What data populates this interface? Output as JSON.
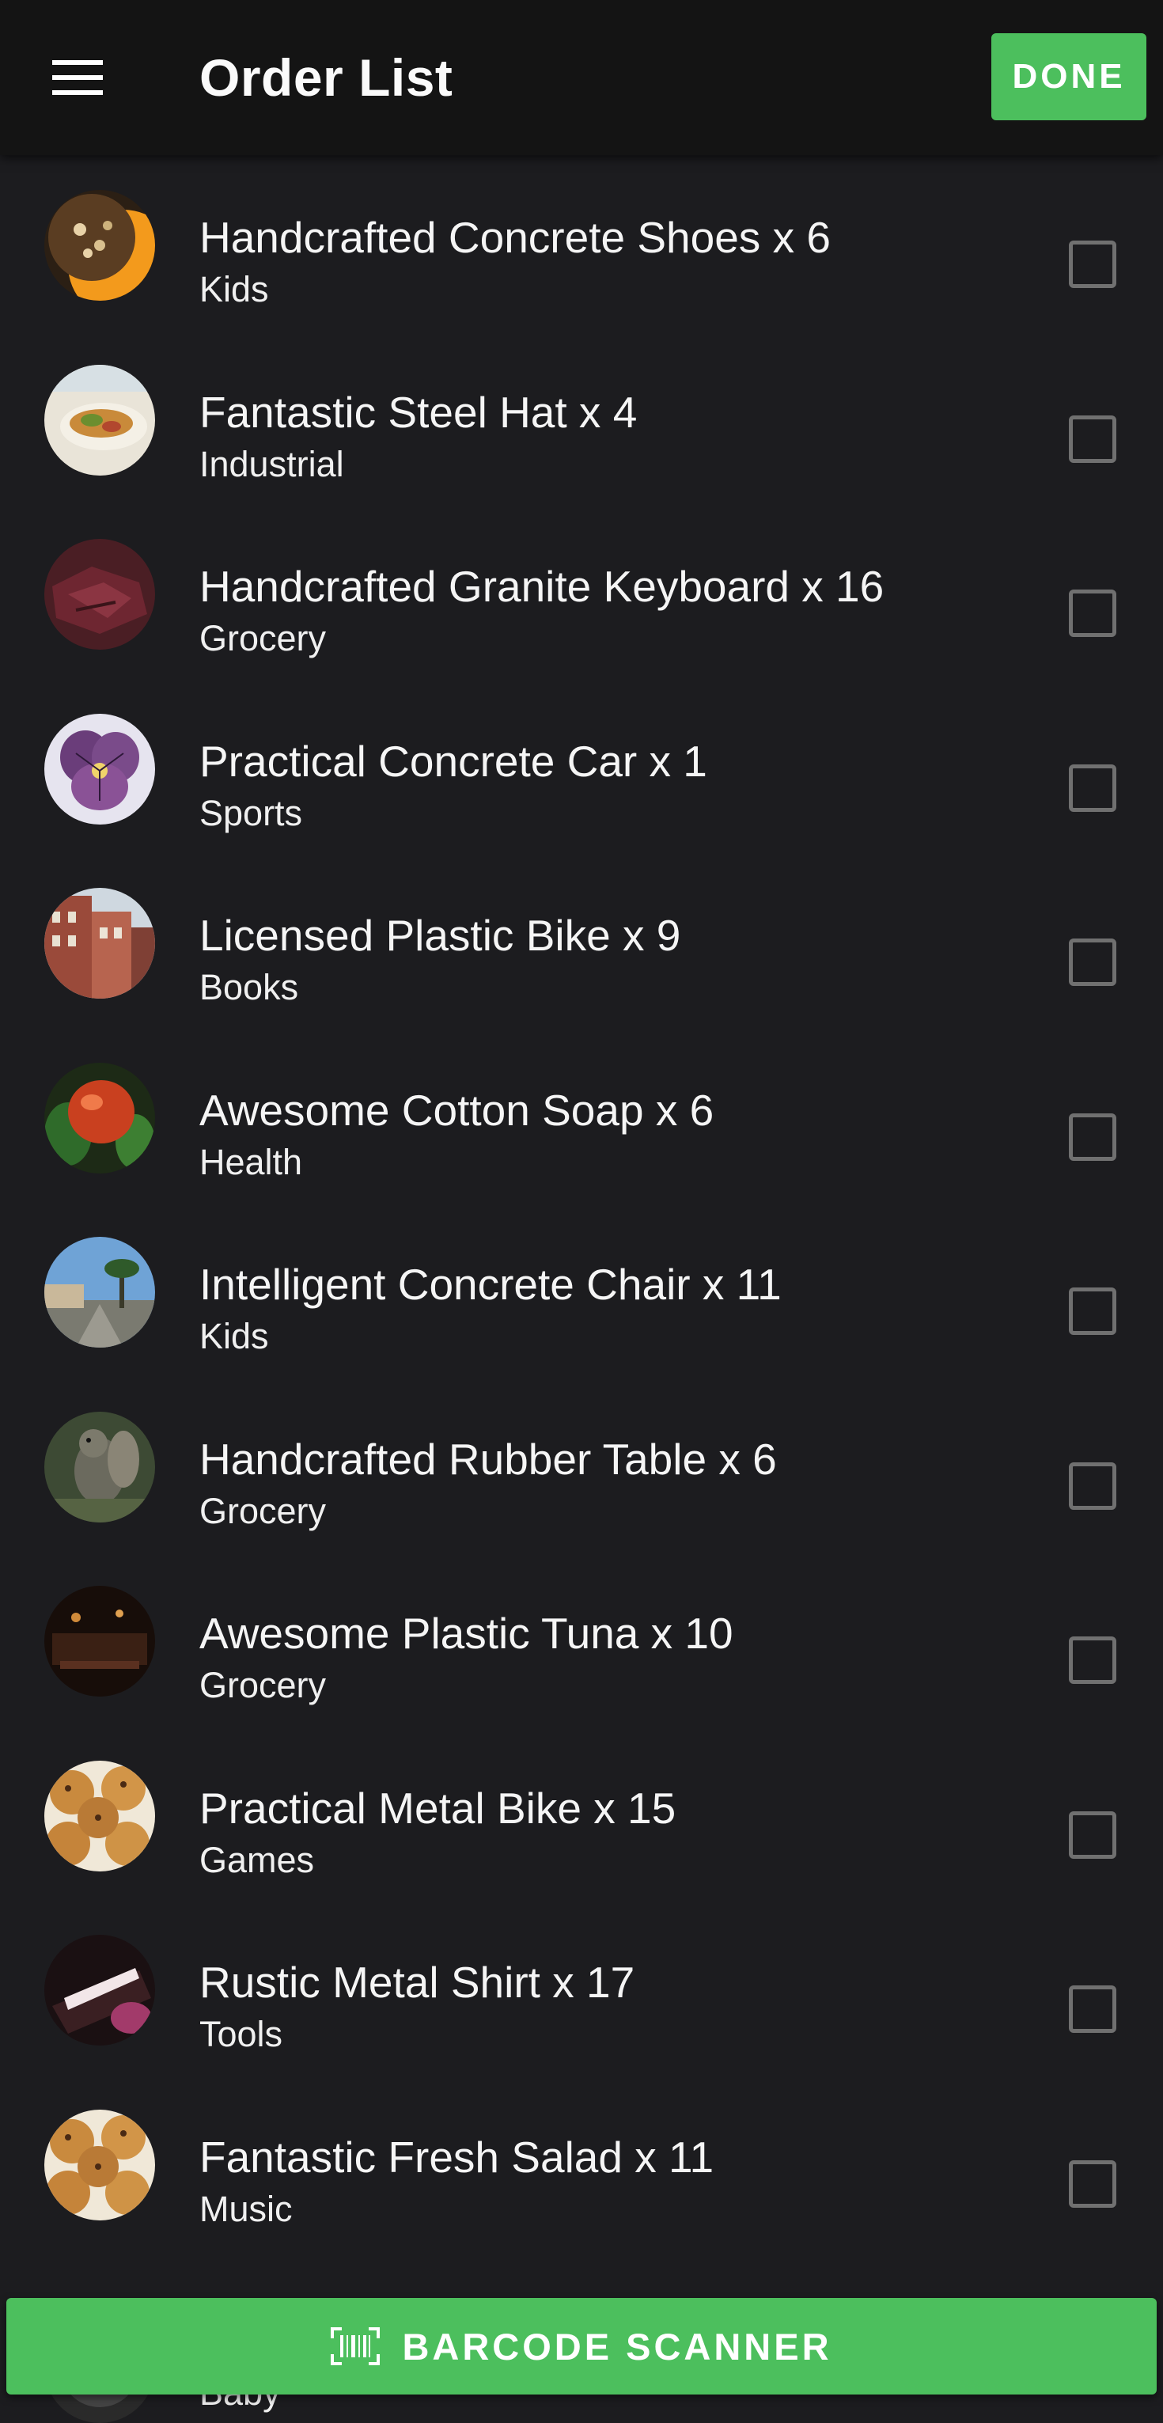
{
  "header": {
    "title": "Order List",
    "done_label": "DONE",
    "menu_icon": "hamburger-menu-icon"
  },
  "items": [
    {
      "title": "Handcrafted Concrete Shoes x 6",
      "category": "Kids",
      "checked": false
    },
    {
      "title": "Fantastic Steel Hat x 4",
      "category": "Industrial",
      "checked": false
    },
    {
      "title": "Handcrafted Granite Keyboard x 16",
      "category": "Grocery",
      "checked": false
    },
    {
      "title": "Practical Concrete Car x 1",
      "category": "Sports",
      "checked": false
    },
    {
      "title": "Licensed Plastic Bike x 9",
      "category": "Books",
      "checked": false
    },
    {
      "title": "Awesome Cotton Soap x 6",
      "category": "Health",
      "checked": false
    },
    {
      "title": "Intelligent Concrete Chair x 11",
      "category": "Kids",
      "checked": false
    },
    {
      "title": "Handcrafted Rubber Table x 6",
      "category": "Grocery",
      "checked": false
    },
    {
      "title": "Awesome Plastic Tuna x 10",
      "category": "Grocery",
      "checked": false
    },
    {
      "title": "Practical Metal Bike x 15",
      "category": "Games",
      "checked": false
    },
    {
      "title": "Rustic Metal Shirt x 17",
      "category": "Tools",
      "checked": false
    },
    {
      "title": "Fantastic Fresh Salad x 11",
      "category": "Music",
      "checked": false
    }
  ],
  "partial_item": {
    "category": "Baby"
  },
  "scanner": {
    "label": "BARCODE SCANNER",
    "icon": "barcode-scan-icon"
  },
  "colors": {
    "accent": "#4cbf5d",
    "background": "#1c1c1f",
    "appbar": "#141414",
    "checkbox_border": "#707070"
  }
}
